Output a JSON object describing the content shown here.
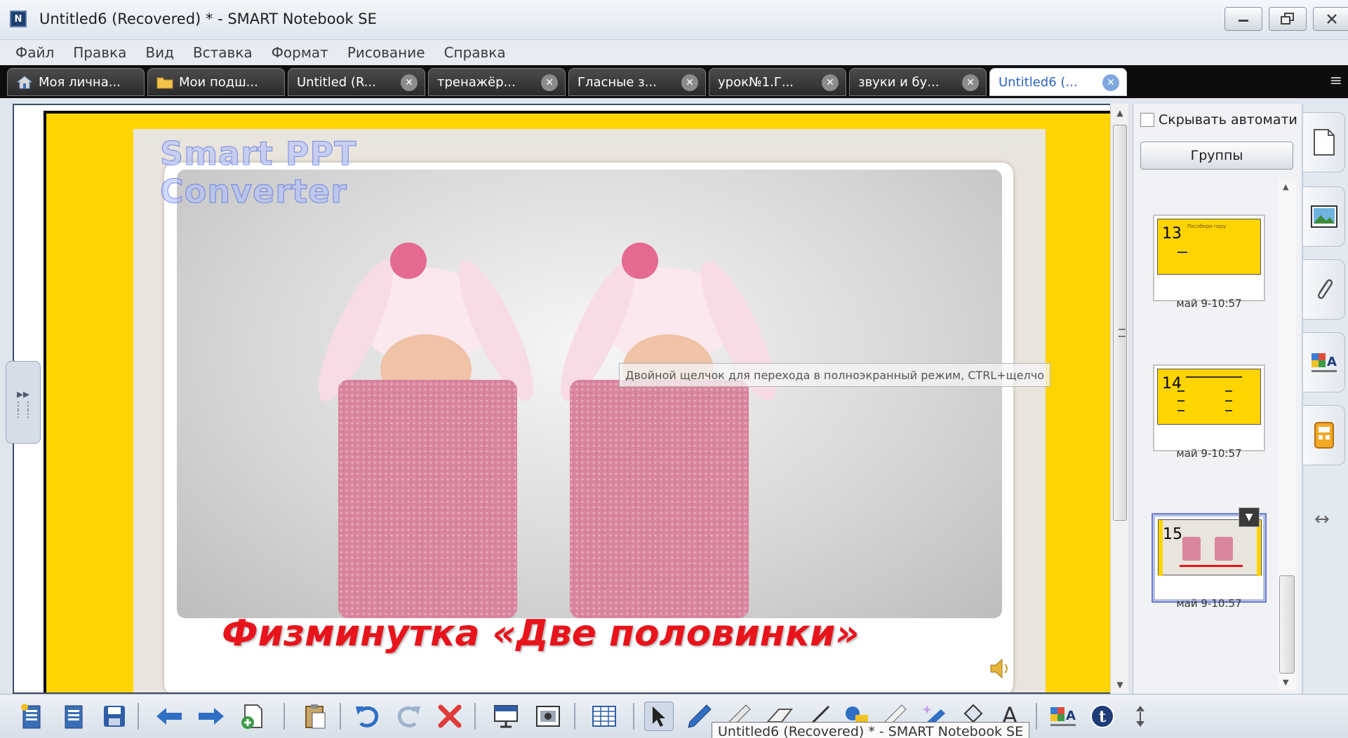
{
  "window": {
    "title": "Untitled6 (Recovered) * - SMART Notebook SE"
  },
  "menu": [
    "Файл",
    "Правка",
    "Вид",
    "Вставка",
    "Формат",
    "Рисование",
    "Справка"
  ],
  "tabs": [
    {
      "label": "Моя лична...",
      "icon": "home-icon",
      "closable": false
    },
    {
      "label": "Мои подш...",
      "icon": "folder-icon",
      "closable": false
    },
    {
      "label": "Untitled (R...",
      "closable": true
    },
    {
      "label": "тренажёр...",
      "closable": true
    },
    {
      "label": "Гласные з...",
      "closable": true
    },
    {
      "label": "урок№1.Г...",
      "closable": true
    },
    {
      "label": "звуки и бу...",
      "closable": true
    },
    {
      "label": "Untitled6 (...",
      "closable": true,
      "active": true
    }
  ],
  "slide": {
    "watermark_line1": "Smart PPT",
    "watermark_line2": "Converter",
    "title": "Физминутка «Две половинки»",
    "tooltip": "Двойной щелчок для перехода в полноэкранный режим, CTRL+щелчо"
  },
  "sorter": {
    "autohide_label": "Скрывать автомати",
    "groups_label": "Группы",
    "pages": [
      {
        "number": "13",
        "date": "май 9-10:57",
        "caption": "Послбери пару"
      },
      {
        "number": "14",
        "date": "май 9-10:57"
      },
      {
        "number": "15",
        "date": "май 9-10:57",
        "selected": true
      }
    ]
  },
  "taskbar_tooltip": "Untitled6 (Recovered) * - SMART Notebook SE",
  "colors": {
    "page_yellow": "#ffd400",
    "slide_title_red": "#e8141c",
    "tabbar_black": "#0d0d0d",
    "active_tab_blue": "#2b64c1"
  }
}
